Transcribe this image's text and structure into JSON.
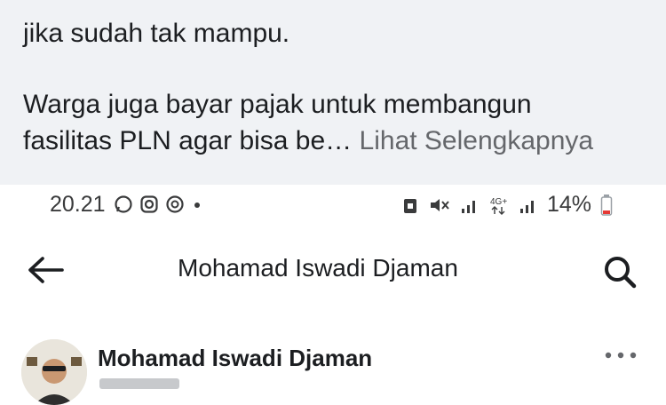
{
  "post": {
    "line_1": "jika sudah tak mampu.",
    "line_2": "Warga juga bayar pajak untuk membangun",
    "line_3_text": "fasilitas PLN agar bisa be…",
    "see_more": "Lihat Selengkapnya"
  },
  "status_bar": {
    "time": "20.21",
    "battery": "14%",
    "left_icons": [
      "whatsapp-icon",
      "instagram-icon",
      "notification-icon",
      "dot-icon"
    ],
    "right_icons": [
      "alarm-icon",
      "mute-icon",
      "signal-icon",
      "network-4g-icon",
      "signal-icon",
      "battery-icon"
    ]
  },
  "header": {
    "title": "Mohamad Iswadi Djaman",
    "back_icon": "arrow-left-icon",
    "search_icon": "search-icon"
  },
  "author": {
    "name": "Mohamad Iswadi Djaman",
    "more_icon": "more-options-icon"
  },
  "colors": {
    "post_background": "#f0f2f5",
    "see_more": "#65676b",
    "battery_low": "#e53935"
  }
}
